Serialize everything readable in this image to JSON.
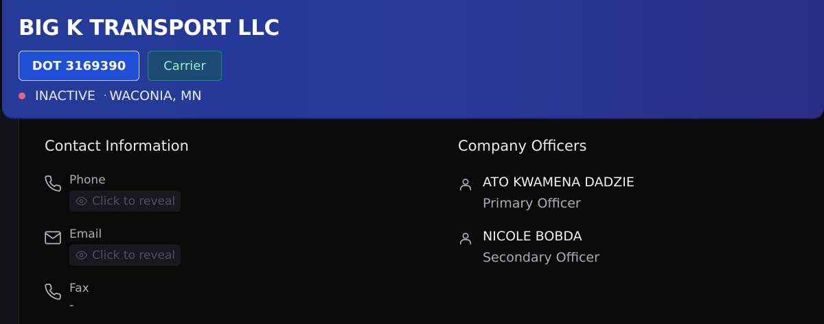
{
  "header": {
    "company_name": "BIG K TRANSPORT LLC",
    "dot_badge": "DOT 3169390",
    "type_badge": "Carrier",
    "status": "INACTIVE",
    "separator": "·",
    "location": "WACONIA, MN",
    "status_color": "#f0616b"
  },
  "contact": {
    "title": "Contact Information",
    "items": [
      {
        "label": "Phone",
        "reveal_label": "Click to reveal",
        "icon": "phone-icon"
      },
      {
        "label": "Email",
        "reveal_label": "Click to reveal",
        "icon": "mail-icon"
      },
      {
        "label": "Fax",
        "value": "-",
        "icon": "phone-icon"
      }
    ]
  },
  "officers": {
    "title": "Company Officers",
    "items": [
      {
        "name": "ATO KWAMENA DADZIE",
        "role": "Primary Officer",
        "icon": "user-icon"
      },
      {
        "name": "NICOLE BOBDA",
        "role": "Secondary Officer",
        "icon": "user-icon"
      }
    ]
  }
}
